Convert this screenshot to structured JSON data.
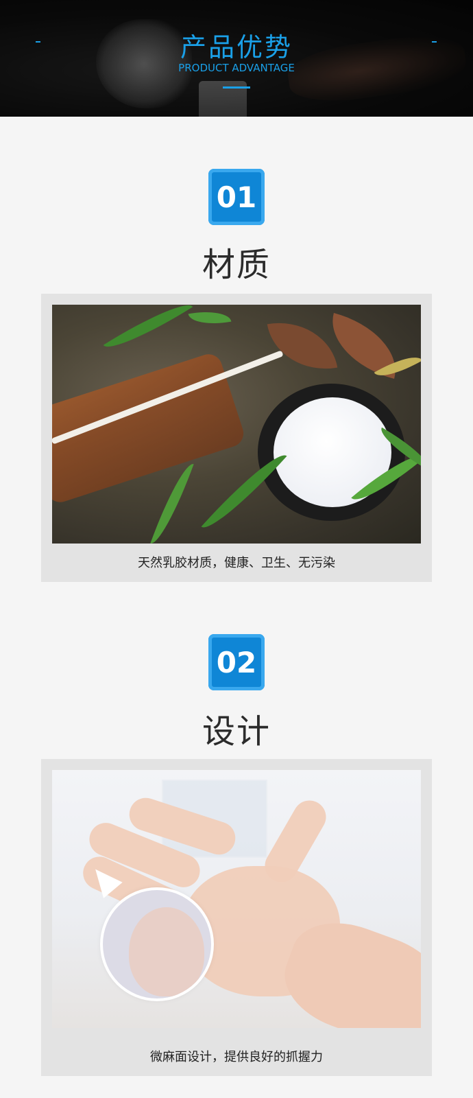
{
  "header": {
    "title": "产品优势",
    "subtitle": "PRODUCT ADVANTAGE"
  },
  "sections": [
    {
      "number": "01",
      "title": "材质",
      "caption": "天然乳胶材质，健康、卫生、无污染",
      "image_subject": "rubber-tree-latex-collection"
    },
    {
      "number": "02",
      "title": "设计",
      "caption": "微麻面设计，提供良好的抓握力",
      "image_subject": "hand-in-textured-glove"
    }
  ],
  "colors": {
    "accent": "#1aa0e8",
    "badge": "#0f86d6",
    "card_bg": "#e3e3e3",
    "page_bg": "#f5f5f5",
    "title_text": "#2b2b2b"
  }
}
